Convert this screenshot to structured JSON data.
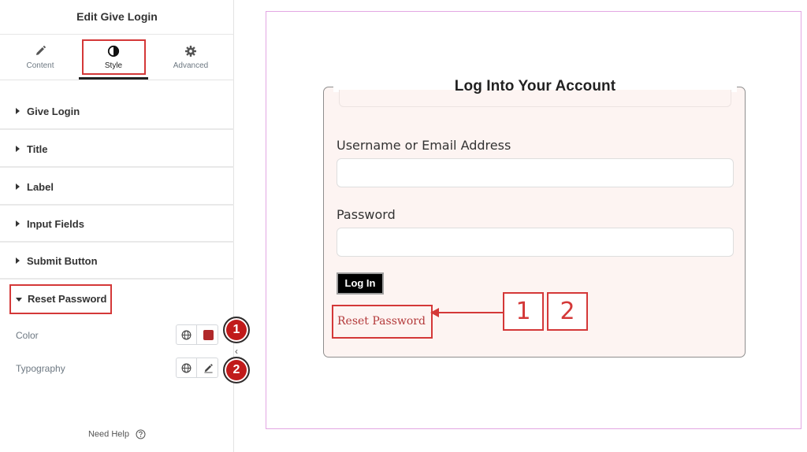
{
  "panel": {
    "title": "Edit Give Login",
    "tabs": [
      {
        "label": "Content",
        "icon": "pencil-icon"
      },
      {
        "label": "Style",
        "icon": "half-circle-contrast-icon",
        "active": true
      },
      {
        "label": "Advanced",
        "icon": "gear-icon"
      }
    ],
    "sections": [
      {
        "label": "Give Login"
      },
      {
        "label": "Title"
      },
      {
        "label": "Label"
      },
      {
        "label": "Input Fields"
      },
      {
        "label": "Submit Button"
      }
    ],
    "open_section": {
      "label": "Reset Password",
      "controls": [
        {
          "label": "Color",
          "icons": [
            "globe-icon",
            "color-swatch"
          ],
          "swatch_color": "#b0282a",
          "badge": "1"
        },
        {
          "label": "Typography",
          "icons": [
            "globe-icon",
            "pencil-icon"
          ],
          "badge": "2"
        }
      ]
    },
    "collapse_arrow": "‹",
    "help": "Need Help"
  },
  "preview": {
    "card_title": "Log Into Your Account",
    "username_label": "Username or Email Address",
    "password_label": "Password",
    "login_button": "Log In",
    "reset_link": "Reset Password",
    "callouts": [
      "1",
      "2"
    ]
  },
  "colors": {
    "annotation_red": "#d43838",
    "reset_link": "#b3393a",
    "card_bg": "#fdf4f2",
    "preview_border": "#e3a6e3"
  }
}
